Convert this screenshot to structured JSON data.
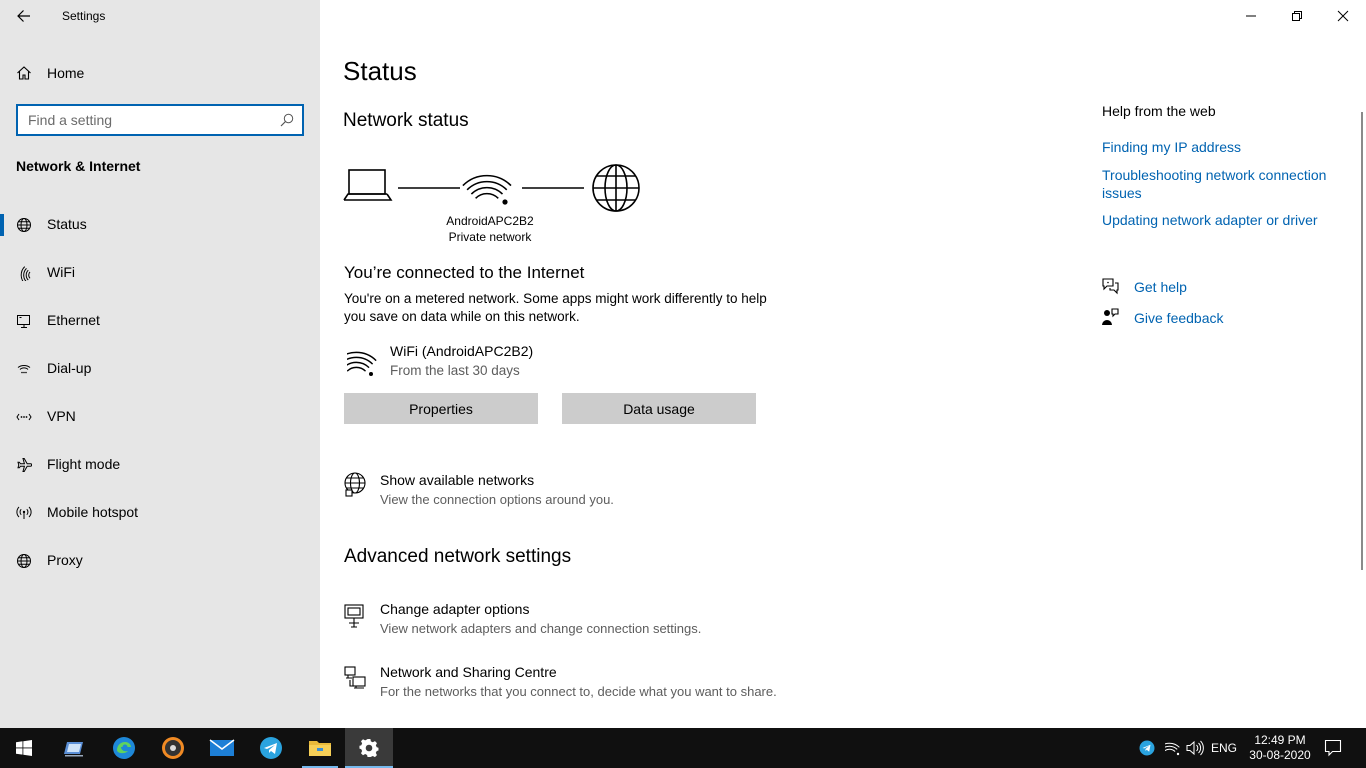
{
  "window": {
    "title": "Settings"
  },
  "sidebar": {
    "home_label": "Home",
    "search_placeholder": "Find a setting",
    "section_title": "Network & Internet",
    "items": [
      {
        "label": "Status",
        "icon": "globe-icon",
        "active": true
      },
      {
        "label": "WiFi",
        "icon": "wifi-icon",
        "active": false
      },
      {
        "label": "Ethernet",
        "icon": "ethernet-icon",
        "active": false
      },
      {
        "label": "Dial-up",
        "icon": "dial-up-icon",
        "active": false
      },
      {
        "label": "VPN",
        "icon": "vpn-icon",
        "active": false
      },
      {
        "label": "Flight mode",
        "icon": "airplane-icon",
        "active": false
      },
      {
        "label": "Mobile hotspot",
        "icon": "hotspot-icon",
        "active": false
      },
      {
        "label": "Proxy",
        "icon": "globe-icon",
        "active": false
      }
    ]
  },
  "main": {
    "title": "Status",
    "network_status_heading": "Network status",
    "network_name": "AndroidAPC2B2",
    "network_type": "Private network",
    "connected_heading": "You’re connected to the Internet",
    "metered_desc": "You're on a metered network. Some apps might work differently to help you save on data while on this network.",
    "connection": {
      "name": "WiFi (AndroidAPC2B2)",
      "period": "From the last 30 days"
    },
    "buttons": {
      "properties": "Properties",
      "data_usage": "Data usage"
    },
    "show_networks": {
      "title": "Show available networks",
      "subtitle": "View the connection options around you."
    },
    "advanced_heading": "Advanced network settings",
    "adapter_options": {
      "title": "Change adapter options",
      "subtitle": "View network adapters and change connection settings."
    },
    "sharing_centre": {
      "title": "Network and Sharing Centre",
      "subtitle": "For the networks that you connect to, decide what you want to share."
    }
  },
  "help": {
    "title": "Help from the web",
    "links": [
      "Finding my IP address",
      "Troubleshooting network connection issues",
      "Updating network adapter or driver"
    ],
    "get_help": "Get help",
    "give_feedback": "Give feedback"
  },
  "taskbar": {
    "language": "ENG",
    "time": "12:49 PM",
    "date": "30-08-2020"
  },
  "colors": {
    "accent": "#0063b1",
    "sidebar_bg": "#e6e6e6",
    "button_bg": "#cccccc",
    "taskbar_bg": "#101010"
  }
}
